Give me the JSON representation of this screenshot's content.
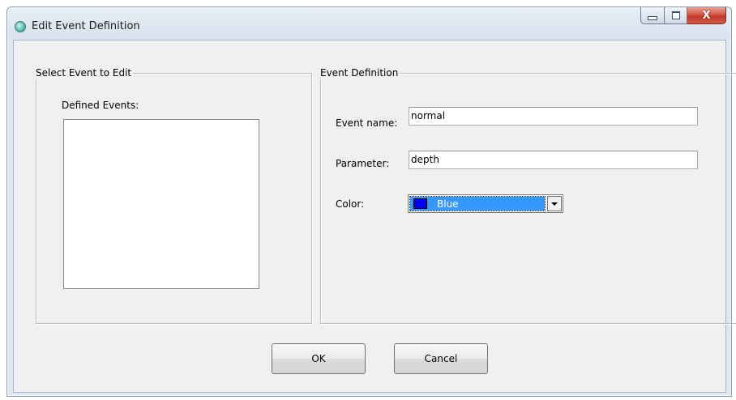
{
  "window": {
    "title": "Edit Event Definition",
    "app_icon": "circle-app-icon",
    "caption_icons": [
      "minimize-icon",
      "maximize-icon",
      "close-icon"
    ],
    "close_glyph": "X"
  },
  "select_group": {
    "title": "Select Event to Edit",
    "list_label": "Defined Events:",
    "items": []
  },
  "definition_group": {
    "title": "Event Definition",
    "event_name_label": "Event name:",
    "event_name_value": "normal",
    "parameter_label": "Parameter:",
    "parameter_value": "depth",
    "color_label": "Color:",
    "color_value": "Blue",
    "color_swatch": "#0000ff"
  },
  "buttons": {
    "ok_label": "OK",
    "cancel_label": "Cancel"
  },
  "colors": {
    "selection": "#3399ff",
    "dialog_bg": "#f0f0f0",
    "close_button": "#c0392b"
  }
}
